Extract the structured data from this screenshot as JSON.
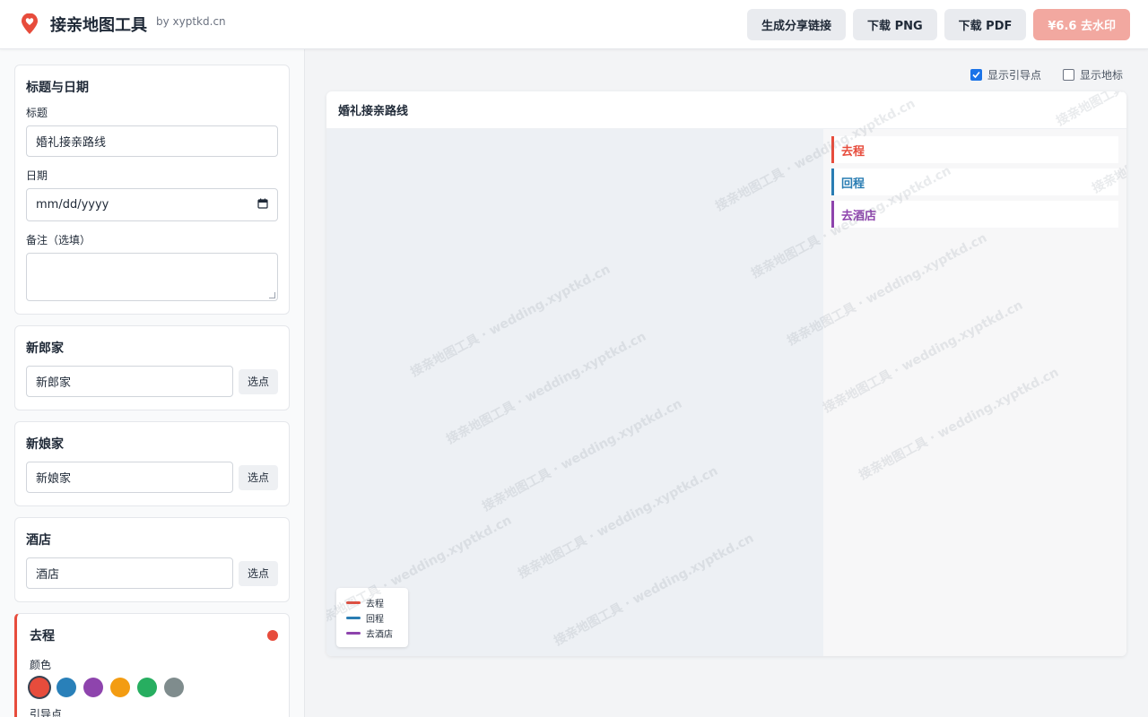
{
  "header": {
    "title": "接亲地图工具",
    "by": "by xyptkd.cn",
    "actions": {
      "share": "生成分享链接",
      "png": "下载 PNG",
      "pdf": "下载 PDF",
      "remove_watermark": "¥6.6 去水印"
    }
  },
  "sidebar": {
    "title_date": {
      "heading": "标题与日期",
      "title_label": "标题",
      "title_value": "婚礼接亲路线",
      "date_label": "日期",
      "date_placeholder": "mm/dd/yyyy",
      "note_label": "备注（选填）"
    },
    "groom": {
      "heading": "新郎家",
      "value": "新郎家",
      "pick": "选点"
    },
    "bride": {
      "heading": "新娘家",
      "value": "新娘家",
      "pick": "选点"
    },
    "hotel": {
      "heading": "酒店",
      "value": "酒店",
      "pick": "选点"
    },
    "route_out": {
      "heading": "去程",
      "color_label": "颜色",
      "guide_label": "引导点",
      "swatches": [
        "#e74c3c",
        "#2980b9",
        "#8e44ad",
        "#f39c12",
        "#27ae60",
        "#7f8c8d"
      ]
    }
  },
  "main": {
    "toggles": {
      "show_guides": "显示引导点",
      "show_landmarks": "显示地标"
    },
    "map_title": "婚礼接亲路线",
    "routes": [
      {
        "label": "去程",
        "color": "#e74c3c"
      },
      {
        "label": "回程",
        "color": "#2a7db3"
      },
      {
        "label": "去酒店",
        "color": "#8e44ad"
      }
    ],
    "legend": [
      {
        "label": "去程",
        "color": "#e74c3c"
      },
      {
        "label": "回程",
        "color": "#2a7db3"
      },
      {
        "label": "去酒店",
        "color": "#8e44ad"
      }
    ],
    "watermark_text": "接亲地图工具 · wedding.xyptkd.cn"
  }
}
